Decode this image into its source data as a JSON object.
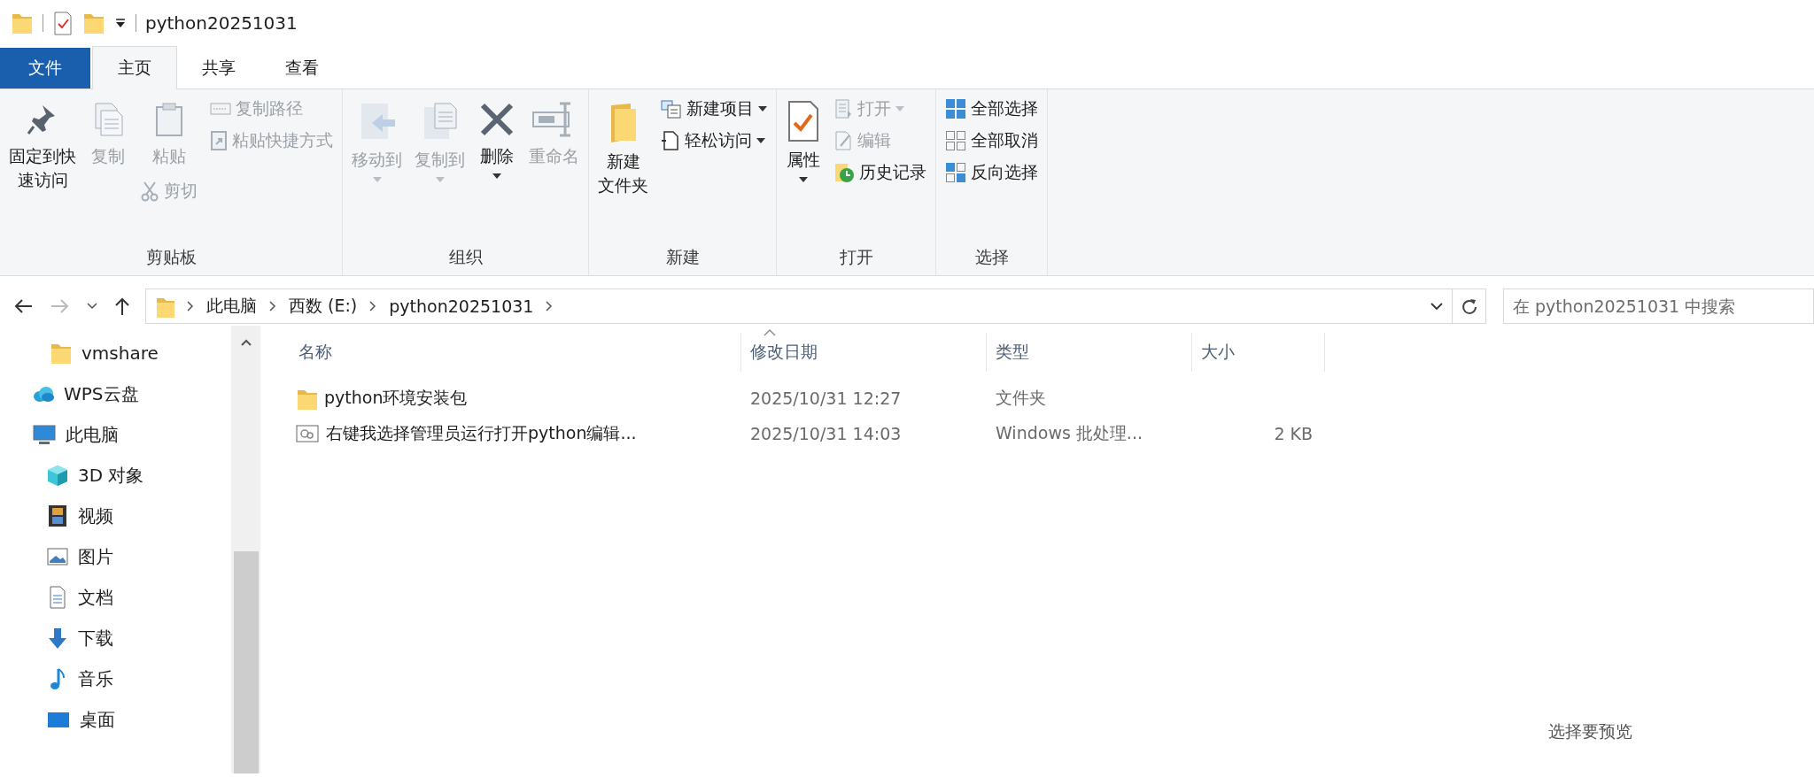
{
  "window": {
    "title": "python20251031"
  },
  "tabs": [
    {
      "label": "文件",
      "kind": "file",
      "selected": false
    },
    {
      "label": "主页",
      "kind": "tab",
      "selected": true
    },
    {
      "label": "共享",
      "kind": "tab",
      "selected": false
    },
    {
      "label": "查看",
      "kind": "tab",
      "selected": false
    }
  ],
  "ribbon": {
    "groups": [
      {
        "label": "剪贴板",
        "columns": [
          [
            {
              "lines": [
                "固定到快",
                "速访问"
              ],
              "kind": "large",
              "disabled": false,
              "dropdown": false
            }
          ],
          [
            {
              "label": "复制",
              "kind": "large",
              "disabled": true,
              "dropdown": false
            }
          ],
          [
            {
              "label": "粘贴",
              "kind": "large",
              "disabled": true,
              "dropdown": false
            },
            {
              "label": "剪切",
              "kind": "small",
              "disabled": true,
              "dropdown": false
            }
          ],
          [
            {
              "label": "复制路径",
              "kind": "small",
              "disabled": true,
              "dropdown": false
            },
            {
              "label": "粘贴快捷方式",
              "kind": "small",
              "disabled": true,
              "dropdown": false
            }
          ]
        ]
      },
      {
        "label": "组织",
        "columns": [
          [
            {
              "label": "移动到",
              "kind": "large",
              "disabled": true,
              "dropdown": true
            }
          ],
          [
            {
              "label": "复制到",
              "kind": "large",
              "disabled": true,
              "dropdown": true
            }
          ],
          [
            {
              "label": "删除",
              "kind": "large",
              "disabled": false,
              "dropdown": true
            }
          ],
          [
            {
              "label": "重命名",
              "kind": "large",
              "disabled": true,
              "dropdown": false
            }
          ]
        ]
      },
      {
        "label": "新建",
        "columns": [
          [
            {
              "lines": [
                "新建",
                "文件夹"
              ],
              "kind": "large",
              "disabled": false,
              "dropdown": false
            }
          ],
          [
            {
              "label": "新建项目",
              "kind": "small",
              "disabled": false,
              "dropdown": true
            },
            {
              "label": "轻松访问",
              "kind": "small",
              "disabled": false,
              "dropdown": true
            }
          ]
        ]
      },
      {
        "label": "打开",
        "columns": [
          [
            {
              "label": "属性",
              "kind": "large",
              "disabled": false,
              "dropdown": true
            }
          ],
          [
            {
              "label": "打开",
              "kind": "small",
              "disabled": true,
              "dropdown": true
            },
            {
              "label": "编辑",
              "kind": "small",
              "disabled": true,
              "dropdown": false
            },
            {
              "label": "历史记录",
              "kind": "small",
              "disabled": false,
              "dropdown": false
            }
          ]
        ]
      },
      {
        "label": "选择",
        "columns": [
          [
            {
              "label": "全部选择",
              "kind": "small",
              "disabled": false,
              "dropdown": false
            },
            {
              "label": "全部取消",
              "kind": "small",
              "disabled": false,
              "dropdown": false
            },
            {
              "label": "反向选择",
              "kind": "small",
              "disabled": false,
              "dropdown": false
            }
          ]
        ]
      }
    ]
  },
  "address": {
    "path": [
      "此电脑",
      "西数 (E:)",
      "python20251031"
    ],
    "search": {
      "placeholder": "在 python20251031 中搜索"
    }
  },
  "sidebar": {
    "items": [
      {
        "label": "vmshare",
        "kind": "pinned-folder"
      },
      {
        "label": "WPS云盘",
        "kind": "cloud"
      },
      {
        "label": "此电脑",
        "kind": "pc",
        "children": [
          {
            "label": "3D 对象",
            "kind": "objects"
          },
          {
            "label": "视频",
            "kind": "video"
          },
          {
            "label": "图片",
            "kind": "pictures"
          },
          {
            "label": "文档",
            "kind": "documents"
          },
          {
            "label": "下载",
            "kind": "downloads"
          },
          {
            "label": "音乐",
            "kind": "music"
          },
          {
            "label": "桌面",
            "kind": "desktop"
          }
        ]
      }
    ]
  },
  "table": {
    "columns": [
      "名称",
      "修改日期",
      "类型",
      "大小"
    ],
    "rows": [
      {
        "kind": "folder",
        "name": "python环境安装包",
        "date": "2025/10/31 12:27",
        "type": "文件夹"
      },
      {
        "kind": "batch",
        "name": "右键我选择管理员运行打开python编辑...",
        "date": "2025/10/31 14:03",
        "type": "Windows 批处理...",
        "size": "2 KB"
      }
    ]
  },
  "preview": {
    "text": "选择要预览"
  }
}
